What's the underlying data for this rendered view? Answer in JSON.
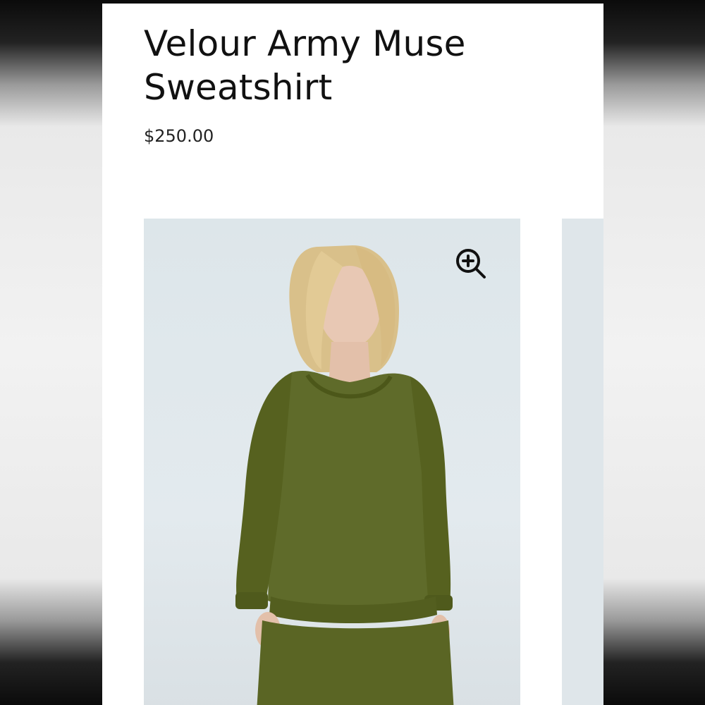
{
  "product": {
    "title": "Velour Army Muse Sweatshirt",
    "price": "$250.00"
  },
  "gallery": {
    "zoom_icon": "zoom-in-icon",
    "photo_subject": "model-photo"
  },
  "colors": {
    "sweatshirt": "#5f6b2a",
    "background": "#dde6ea"
  }
}
